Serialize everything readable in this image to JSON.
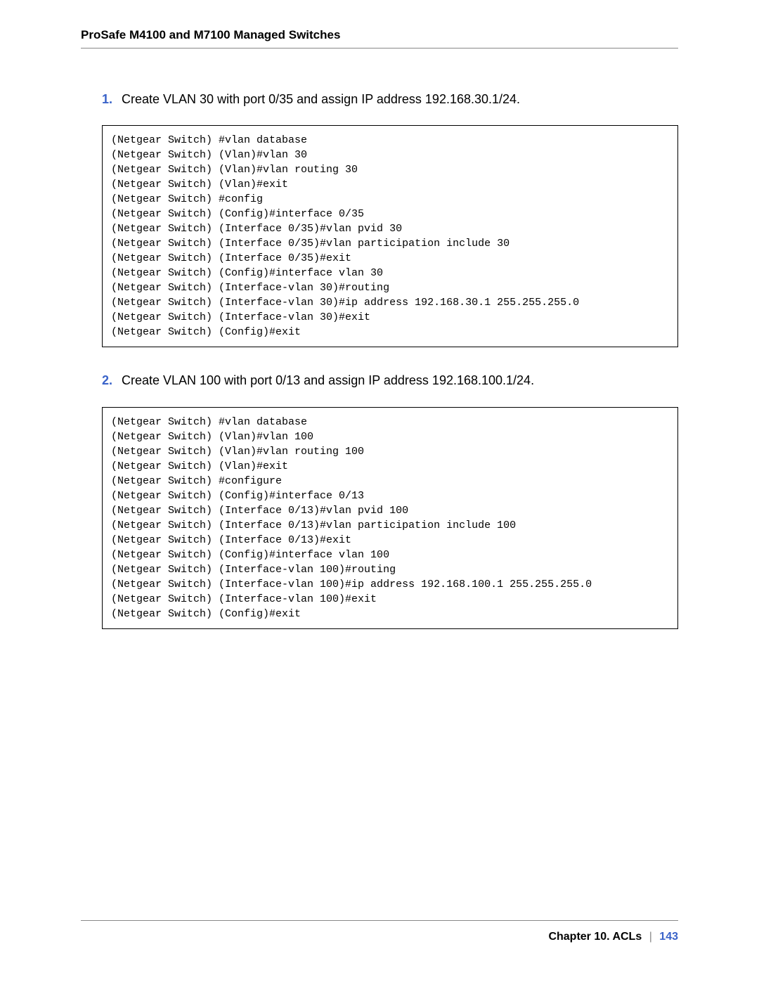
{
  "header": {
    "title": "ProSafe M4100 and M7100 Managed Switches"
  },
  "step1": {
    "number": "1.",
    "text": "Create VLAN 30 with port 0/35 and assign IP address 192.168.30.1/24.",
    "code": "(Netgear Switch) #vlan database\n(Netgear Switch) (Vlan)#vlan 30\n(Netgear Switch) (Vlan)#vlan routing 30\n(Netgear Switch) (Vlan)#exit\n(Netgear Switch) #config\n(Netgear Switch) (Config)#interface 0/35\n(Netgear Switch) (Interface 0/35)#vlan pvid 30\n(Netgear Switch) (Interface 0/35)#vlan participation include 30\n(Netgear Switch) (Interface 0/35)#exit\n(Netgear Switch) (Config)#interface vlan 30\n(Netgear Switch) (Interface-vlan 30)#routing\n(Netgear Switch) (Interface-vlan 30)#ip address 192.168.30.1 255.255.255.0\n(Netgear Switch) (Interface-vlan 30)#exit\n(Netgear Switch) (Config)#exit"
  },
  "step2": {
    "number": "2.",
    "text": "Create VLAN 100 with port 0/13 and assign IP address 192.168.100.1/24.",
    "code": "(Netgear Switch) #vlan database\n(Netgear Switch) (Vlan)#vlan 100\n(Netgear Switch) (Vlan)#vlan routing 100\n(Netgear Switch) (Vlan)#exit\n(Netgear Switch) #configure\n(Netgear Switch) (Config)#interface 0/13\n(Netgear Switch) (Interface 0/13)#vlan pvid 100\n(Netgear Switch) (Interface 0/13)#vlan participation include 100\n(Netgear Switch) (Interface 0/13)#exit\n(Netgear Switch) (Config)#interface vlan 100\n(Netgear Switch) (Interface-vlan 100)#routing\n(Netgear Switch) (Interface-vlan 100)#ip address 192.168.100.1 255.255.255.0\n(Netgear Switch) (Interface-vlan 100)#exit\n(Netgear Switch) (Config)#exit"
  },
  "footer": {
    "chapter": "Chapter 10.  ACLs",
    "separator": "|",
    "page_number": "143"
  }
}
